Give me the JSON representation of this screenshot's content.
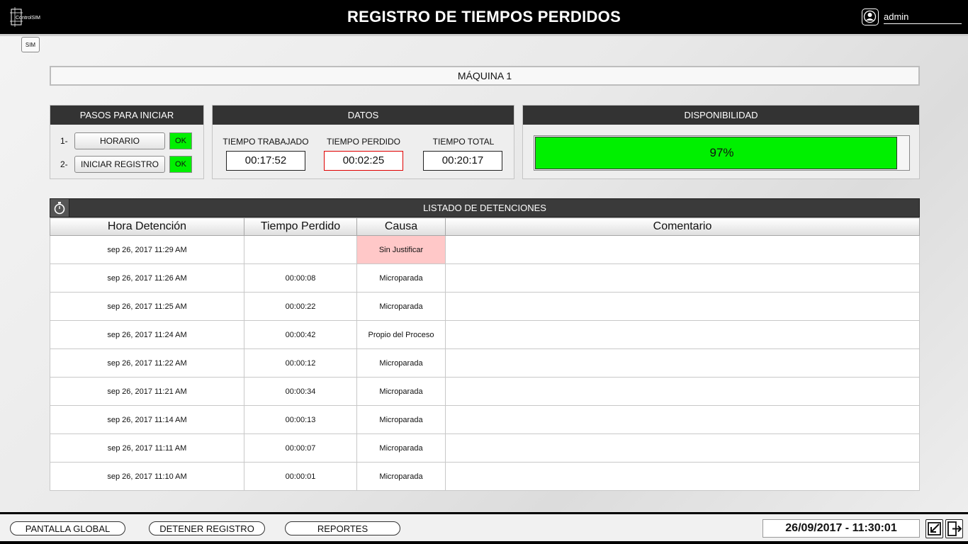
{
  "header": {
    "logo_text": "ControlSIM",
    "title": "REGISTRO DE TIEMPOS PERDIDOS",
    "user": "admin"
  },
  "sim_button": "SIM",
  "machine": "MÁQUINA 1",
  "steps_panel": {
    "title": "PASOS PARA INICIAR",
    "steps": [
      {
        "num": "1-",
        "label": "HORARIO",
        "status": "OK"
      },
      {
        "num": "2-",
        "label": "INICIAR REGISTRO",
        "status": "OK"
      }
    ]
  },
  "data_panel": {
    "title": "DATOS",
    "worked_label": "TIEMPO TRABAJADO",
    "worked_value": "00:17:52",
    "lost_label": "TIEMPO PERDIDO",
    "lost_value": "00:02:25",
    "total_label": "TIEMPO TOTAL",
    "total_value": "00:20:17"
  },
  "availability_panel": {
    "title": "DISPONIBILIDAD",
    "value_text": "97%",
    "fraction": 0.97,
    "fill_color": "#00f000"
  },
  "stops_list": {
    "title": "LISTADO DE DETENCIONES",
    "icon": "stopwatch-icon",
    "columns": [
      "Hora Detención",
      "Tiempo Perdido",
      "Causa",
      "Comentario"
    ],
    "rows": [
      {
        "time": "sep 26, 2017 11:29 AM",
        "lost": "",
        "cause": "Sin Justificar",
        "comment": ""
      },
      {
        "time": "sep 26, 2017 11:26 AM",
        "lost": "00:00:08",
        "cause": "Microparada",
        "comment": ""
      },
      {
        "time": "sep 26, 2017 11:25 AM",
        "lost": "00:00:22",
        "cause": "Microparada",
        "comment": ""
      },
      {
        "time": "sep 26, 2017 11:24 AM",
        "lost": "00:00:42",
        "cause": "Propio del Proceso",
        "comment": ""
      },
      {
        "time": "sep 26, 2017 11:22 AM",
        "lost": "00:00:12",
        "cause": "Microparada",
        "comment": ""
      },
      {
        "time": "sep 26, 2017 11:21 AM",
        "lost": "00:00:34",
        "cause": "Microparada",
        "comment": ""
      },
      {
        "time": "sep 26, 2017 11:14 AM",
        "lost": "00:00:13",
        "cause": "Microparada",
        "comment": ""
      },
      {
        "time": "sep 26, 2017 11:11 AM",
        "lost": "00:00:07",
        "cause": "Microparada",
        "comment": ""
      },
      {
        "time": "sep 26, 2017 11:10 AM",
        "lost": "00:00:01",
        "cause": "Microparada",
        "comment": ""
      }
    ]
  },
  "footer": {
    "global_button": "PANTALLA GLOBAL",
    "stop_button": "DETENER REGISTRO",
    "reports_button": "REPORTES",
    "datetime": "26/09/2017 - 11:30:01"
  }
}
